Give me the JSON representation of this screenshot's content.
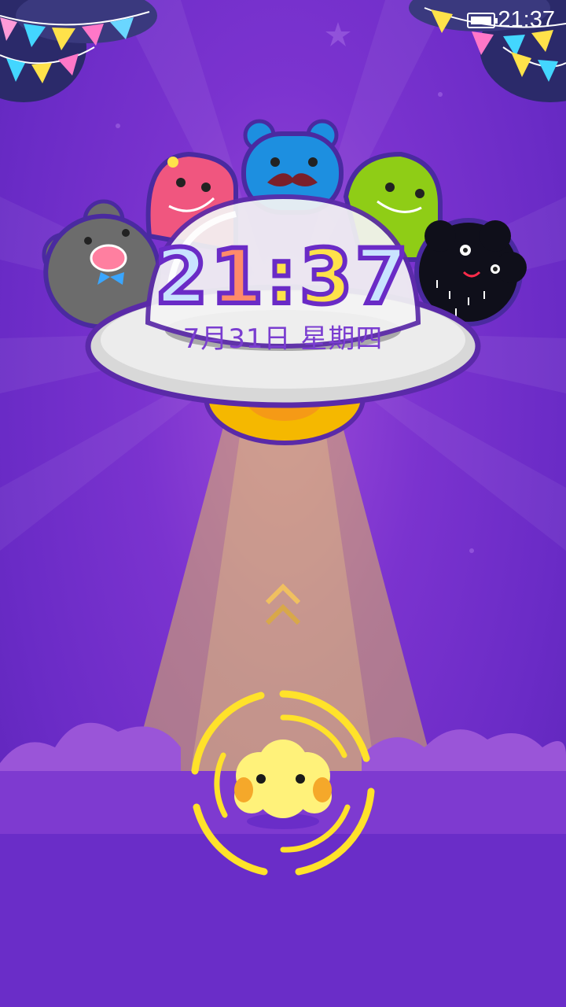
{
  "status_bar": {
    "time": "21:37",
    "battery_icon": "battery-icon"
  },
  "lockscreen": {
    "clock": {
      "hour_tens": "2",
      "hour_ones": "1",
      "separator": ":",
      "minute_tens": "3",
      "minute_ones": "7"
    },
    "date": "7月31日  星期四",
    "icons": {
      "swipe_up": "chevron-up-icon",
      "unlock": "yellow-monster-unlock-icon"
    }
  },
  "colors": {
    "background": "#7b33cf",
    "beam": "#f5d24a",
    "ring": "#ffe22a",
    "ufo": "#e6e6e6"
  }
}
